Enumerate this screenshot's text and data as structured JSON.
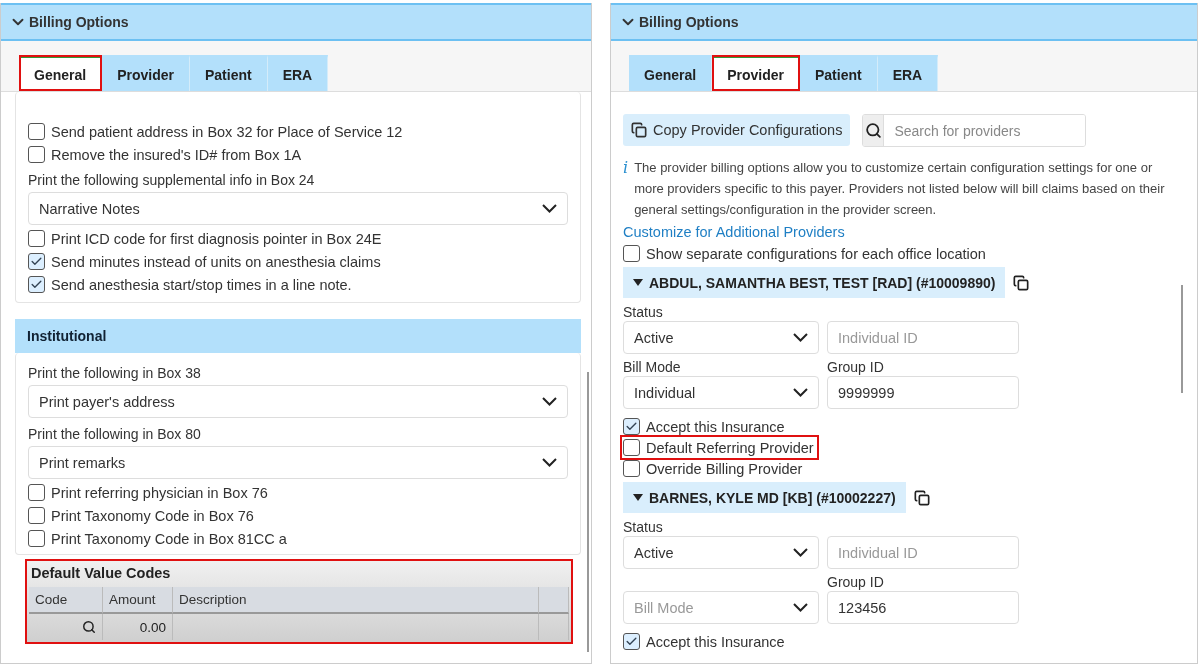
{
  "left_panel": {
    "title": "Billing Options",
    "tabs": [
      {
        "label": "General",
        "selected": true,
        "highlighted": true
      },
      {
        "label": "Provider",
        "selected": false,
        "highlighted": false
      },
      {
        "label": "Patient",
        "selected": false,
        "highlighted": false
      },
      {
        "label": "ERA",
        "selected": false,
        "highlighted": false
      }
    ],
    "general_items": [
      {
        "kind": "checkbox",
        "label": "Send patient address in Box 32 for Place of Service 12",
        "checked": false
      },
      {
        "kind": "checkbox",
        "label": "Remove the insured's ID# from Box 1A",
        "checked": false
      },
      {
        "kind": "select",
        "label": "Print the following supplemental info in Box 24",
        "value": "Narrative Notes"
      },
      {
        "kind": "checkbox",
        "label": "Print ICD code for first diagnosis pointer in Box 24E",
        "checked": false
      },
      {
        "kind": "checkbox",
        "label": "Send minutes instead of units on anesthesia claims",
        "checked": true
      },
      {
        "kind": "checkbox",
        "label": "Send anesthesia start/stop times in a line note.",
        "checked": true
      }
    ],
    "institutional": {
      "title": "Institutional",
      "items": [
        {
          "kind": "select",
          "label": "Print the following in Box 38",
          "value": "Print payer's address"
        },
        {
          "kind": "select",
          "label": "Print the following in Box 80",
          "value": "Print remarks"
        },
        {
          "kind": "checkbox",
          "label": "Print referring physician in Box 76",
          "checked": false
        },
        {
          "kind": "checkbox",
          "label": "Print Taxonomy Code in Box 76",
          "checked": false
        },
        {
          "kind": "checkbox",
          "label": "Print Taxonomy Code in Box 81CC a",
          "checked": false
        }
      ]
    },
    "value_codes": {
      "title": "Default Value Codes",
      "highlighted": true,
      "columns": [
        "Code",
        "Amount",
        "Description"
      ],
      "rows": [
        {
          "amount": "0.00"
        }
      ]
    }
  },
  "right_panel": {
    "title": "Billing Options",
    "tabs": [
      {
        "label": "General",
        "selected": false,
        "highlighted": false
      },
      {
        "label": "Provider",
        "selected": true,
        "highlighted": true
      },
      {
        "label": "Patient",
        "selected": false,
        "highlighted": false
      },
      {
        "label": "ERA",
        "selected": false,
        "highlighted": false
      }
    ],
    "copy_button": "Copy Provider Configurations",
    "search": {
      "placeholder": "Search for providers"
    },
    "info_icon": "i",
    "info": "The provider billing options allow you to customize certain configuration settings for one or more providers specific to this payer. Providers not listed below will bill claims based on their general settings/configuration in the provider screen.",
    "link": "Customize for Additional Providers",
    "office_option": {
      "label": "Show separate configurations for each office location",
      "checked": false
    },
    "providers": [
      {
        "name": "ABDUL, SAMANTHA BEST, TEST [RAD] (#10009890)",
        "status_label": "Status",
        "status": "Active",
        "individual_placeholder": "Individual ID",
        "bill_mode_label": "Bill Mode",
        "bill_mode": {
          "value": "Individual"
        },
        "group_label": "Group ID",
        "group_id": "9999999",
        "options": [
          {
            "label": "Accept this Insurance",
            "checked": true,
            "highlighted": false
          },
          {
            "label": "Default Referring Provider",
            "checked": false,
            "highlighted": true
          },
          {
            "label": "Override Billing Provider",
            "checked": false,
            "highlighted": false
          }
        ]
      },
      {
        "name": "BARNES, KYLE MD [KB] (#10002227)",
        "status_label": "Status",
        "status": "Active",
        "individual_placeholder": "Individual ID",
        "bill_mode": {
          "placeholder": "Bill Mode"
        },
        "group_label": "Group ID",
        "group_id": "123456",
        "options": [
          {
            "label": "Accept this Insurance",
            "checked": true,
            "highlighted": false
          }
        ]
      }
    ]
  }
}
